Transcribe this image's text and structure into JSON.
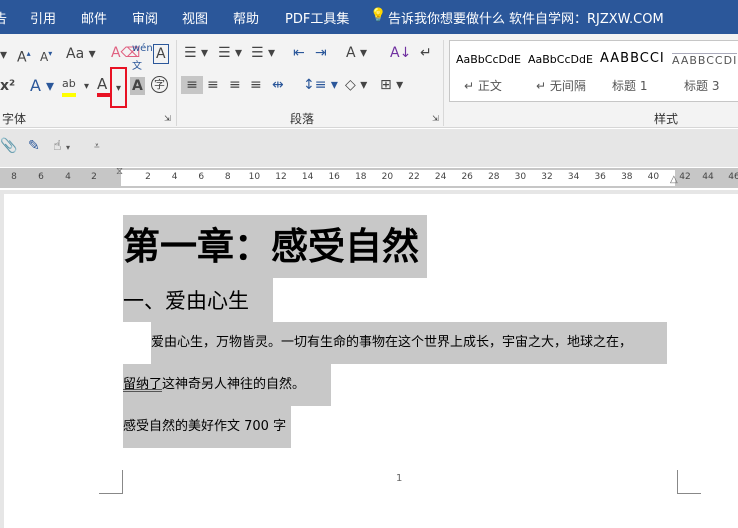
{
  "tabs": [
    "告",
    "引用",
    "邮件",
    "审阅",
    "视图",
    "帮助",
    "PDF工具集"
  ],
  "tell_me": "告诉我你想要做什么",
  "site": "软件自学网：RJZXW.COM",
  "groups": {
    "font": "字体",
    "paragraph": "段落",
    "styles": "样式"
  },
  "styles": [
    {
      "preview": "AaBbCcDdE",
      "label": "↵ 正文"
    },
    {
      "preview": "AaBbCcDdE",
      "label": "↵ 无间隔"
    },
    {
      "preview": "AABBCCI",
      "label": "标题 1"
    },
    {
      "preview": "AABBCCDI",
      "label": "标题 3"
    }
  ],
  "icons": {
    "font_color": "#e81123",
    "highlight": "#ffff00",
    "highlight_box": "#e81123"
  },
  "ruler": {
    "left": [
      "8",
      "6",
      "4",
      "2"
    ],
    "main": [
      "2",
      "4",
      "6",
      "8",
      "10",
      "12",
      "14",
      "16",
      "18",
      "20",
      "22",
      "24",
      "26",
      "28",
      "30",
      "32",
      "34",
      "36",
      "38",
      "40"
    ],
    "right": [
      "42",
      "44",
      "46"
    ]
  },
  "doc": {
    "title": "第一章：感受自然",
    "heading": "一、爱由心生",
    "para1": "爱由心生，万物皆灵。一切有生命的事物在这个世界上成长，宇宙之大，地球之在，",
    "para2_underlined": "留纳了",
    "para2": "这神奇另人神往的自然。",
    "para3": "感受自然的美好作文 700 字",
    "page_number": "1"
  }
}
